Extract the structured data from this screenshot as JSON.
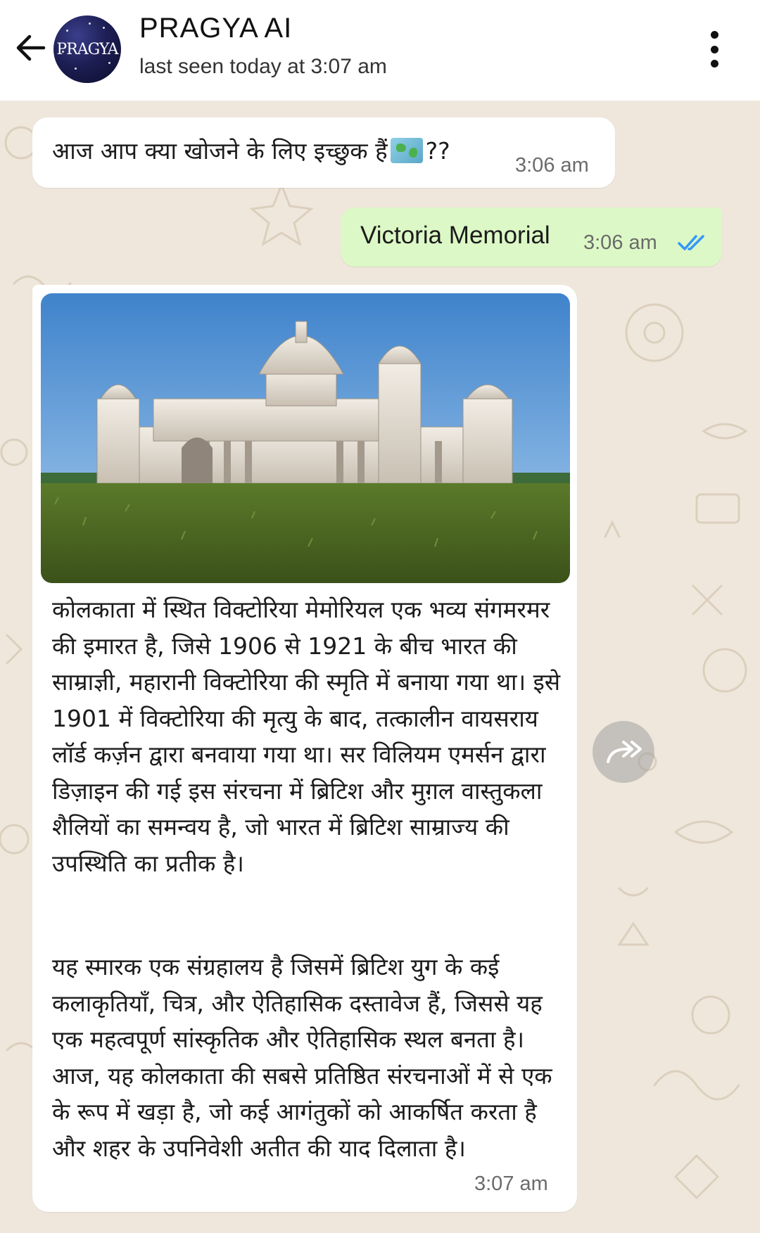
{
  "header": {
    "back_icon": "arrow-left-icon",
    "avatar_text": "PRAGYA",
    "title": "PRAGYA AI",
    "subtitle": "last seen today at 3:07 am",
    "menu_icon": "more-vertical-icon"
  },
  "messages": [
    {
      "direction": "incoming",
      "text": "आज आप क्या खोजने के लिए इच्छुक हैं",
      "emoji": "world-map-icon",
      "suffix": "??",
      "time": "3:06 am"
    },
    {
      "direction": "outgoing",
      "text": "Victoria Memorial",
      "time": "3:06 am",
      "status": "read",
      "status_color": "#3497f9"
    },
    {
      "direction": "incoming",
      "image": "victoria-memorial-photo",
      "paragraphs": [
        "कोलकाता में स्थित विक्टोरिया मेमोरियल एक भव्य संगमरमर की इमारत है, जिसे 1906 से 1921 के बीच भारत की साम्राज्ञी, महारानी विक्टोरिया की स्मृति में बनाया गया था। इसे 1901 में विक्टोरिया की मृत्यु के बाद, तत्कालीन वायसराय लॉर्ड कर्ज़न द्वारा बनवाया गया था। सर विलियम एमर्सन द्वारा डिज़ाइन की गई इस संरचना में ब्रिटिश और मुग़ल वास्तुकला शैलियों का समन्वय है, जो भारत में ब्रिटिश साम्राज्य की उपस्थिति का प्रतीक है।",
        "यह स्मारक एक संग्रहालय है जिसमें ब्रिटिश युग के कई कलाकृतियाँ, चित्र, और ऐतिहासिक दस्तावेज हैं, जिससे यह एक महत्वपूर्ण सांस्कृतिक और ऐतिहासिक स्थल बनता है। आज, यह कोलकाता की सबसे प्रतिष्ठित संरचनाओं में से एक के रूप में खड़ा है, जो कई आगंतुकों को आकर्षित करता है और शहर के उपनिवेशी अतीत की याद दिलाता है।"
      ],
      "time": "3:07 am",
      "forward_icon": "forward-arrow-icon"
    }
  ],
  "colors": {
    "chat_background": "#efe7dc",
    "incoming_bubble": "#ffffff",
    "outgoing_bubble": "#dcf8c6"
  }
}
